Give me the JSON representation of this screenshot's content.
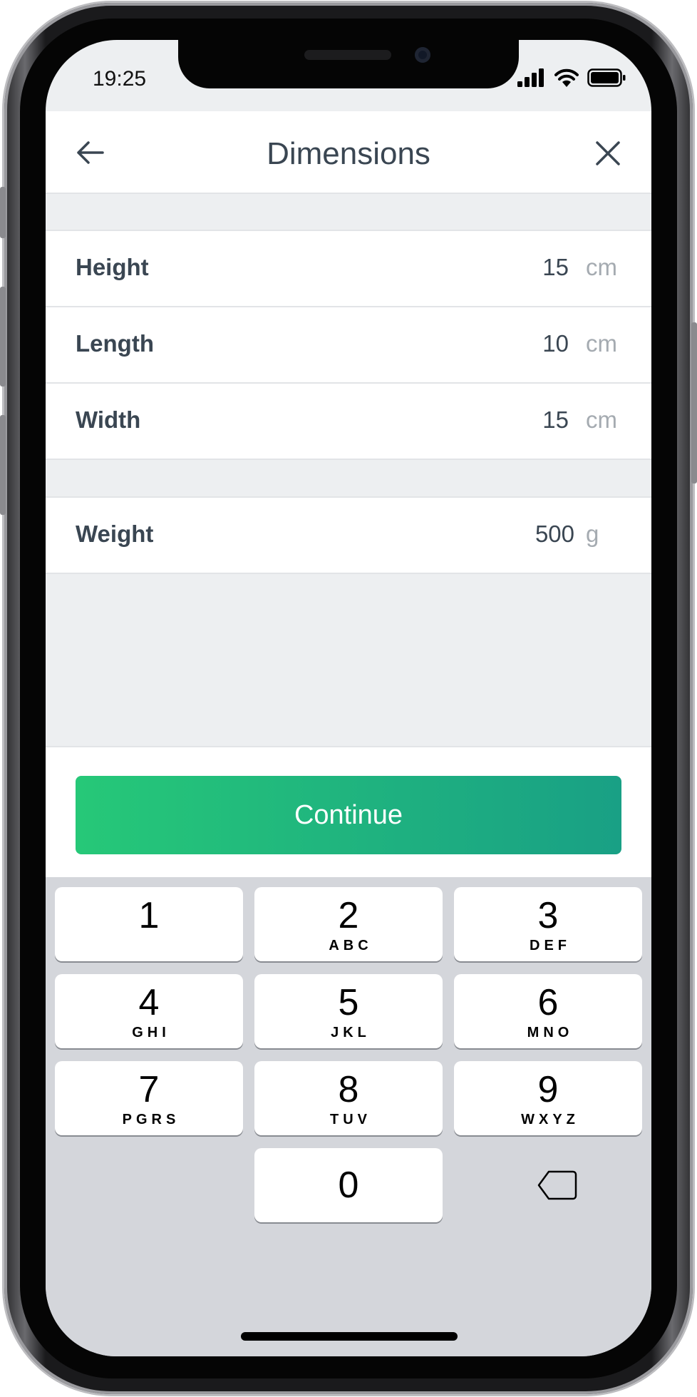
{
  "status_bar": {
    "time": "19:25"
  },
  "nav": {
    "title": "Dimensions",
    "back_icon": "arrow-left-icon",
    "close_icon": "close-icon"
  },
  "dimensions": [
    {
      "label": "Height",
      "value": "15",
      "unit": "cm"
    },
    {
      "label": "Length",
      "value": "10",
      "unit": "cm"
    },
    {
      "label": "Width",
      "value": "15",
      "unit": "cm"
    }
  ],
  "weight": {
    "label": "Weight",
    "value": "500",
    "unit": "g"
  },
  "continue_label": "Continue",
  "colors": {
    "accent_start": "#26c878",
    "accent_end": "#19a085",
    "text": "#3a4652",
    "unit_text": "#a5abb1"
  },
  "keypad": {
    "keys": [
      {
        "digit": "1",
        "letters": ""
      },
      {
        "digit": "2",
        "letters": "ABC"
      },
      {
        "digit": "3",
        "letters": "DEF"
      },
      {
        "digit": "4",
        "letters": "GHI"
      },
      {
        "digit": "5",
        "letters": "JKL"
      },
      {
        "digit": "6",
        "letters": "MNO"
      },
      {
        "digit": "7",
        "letters": "PGRS"
      },
      {
        "digit": "8",
        "letters": "TUV"
      },
      {
        "digit": "9",
        "letters": "WXYZ"
      },
      {
        "digit": "0",
        "letters": ""
      }
    ],
    "backspace_icon": "backspace-icon"
  }
}
